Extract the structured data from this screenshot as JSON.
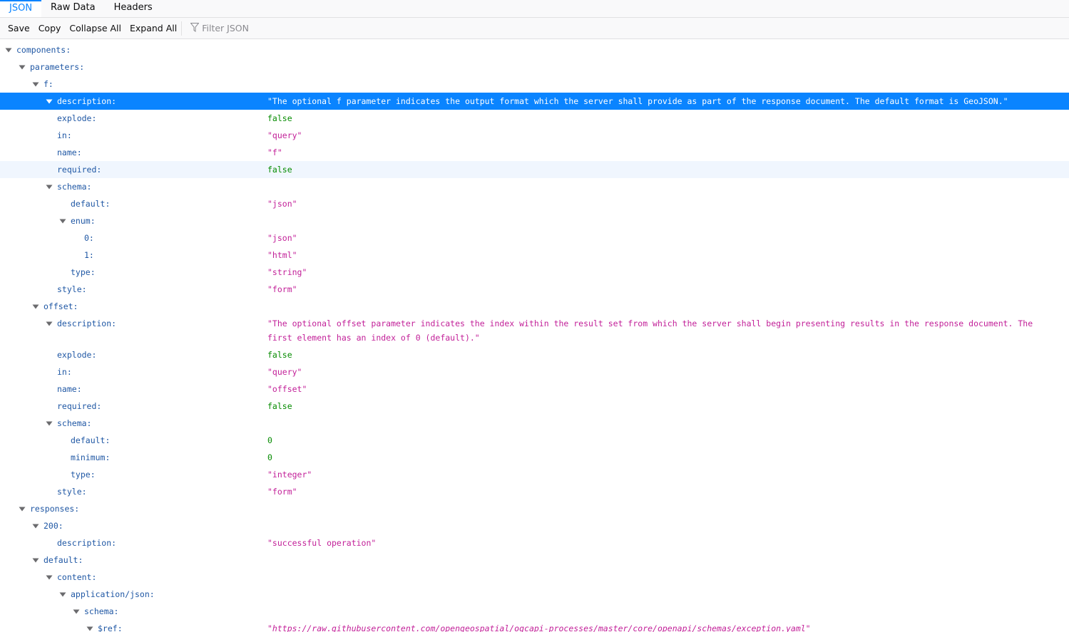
{
  "tabs": {
    "json": "JSON",
    "raw": "Raw Data",
    "headers": "Headers"
  },
  "toolbar": {
    "save": "Save",
    "copy": "Copy",
    "collapse_all": "Collapse All",
    "expand_all": "Expand All",
    "filter_placeholder": "Filter JSON"
  },
  "rows": [
    {
      "depth": 0,
      "key": "components:",
      "tw": true,
      "value": "",
      "type": ""
    },
    {
      "depth": 1,
      "key": "parameters:",
      "tw": true,
      "value": "",
      "type": ""
    },
    {
      "depth": 2,
      "key": "f:",
      "tw": true,
      "value": "",
      "type": ""
    },
    {
      "depth": 3,
      "key": "description:",
      "tw": true,
      "value": "\"The optional f parameter indicates the output format which the server shall provide as part of the response document.  The default format is GeoJSON.\"",
      "type": "str",
      "state": "selected"
    },
    {
      "depth": 3,
      "key": "explode:",
      "tw": false,
      "value": "false",
      "type": "bool"
    },
    {
      "depth": 3,
      "key": "in:",
      "tw": false,
      "value": "\"query\"",
      "type": "str"
    },
    {
      "depth": 3,
      "key": "name:",
      "tw": false,
      "value": "\"f\"",
      "type": "str"
    },
    {
      "depth": 3,
      "key": "required:",
      "tw": false,
      "value": "false",
      "type": "bool",
      "state": "hover"
    },
    {
      "depth": 3,
      "key": "schema:",
      "tw": true,
      "value": "",
      "type": ""
    },
    {
      "depth": 4,
      "key": "default:",
      "tw": false,
      "value": "\"json\"",
      "type": "str"
    },
    {
      "depth": 4,
      "key": "enum:",
      "tw": true,
      "value": "",
      "type": ""
    },
    {
      "depth": 5,
      "key": "0:",
      "tw": false,
      "value": "\"json\"",
      "type": "str"
    },
    {
      "depth": 5,
      "key": "1:",
      "tw": false,
      "value": "\"html\"",
      "type": "str"
    },
    {
      "depth": 4,
      "key": "type:",
      "tw": false,
      "value": "\"string\"",
      "type": "str"
    },
    {
      "depth": 3,
      "key": "style:",
      "tw": false,
      "value": "\"form\"",
      "type": "str"
    },
    {
      "depth": 2,
      "key": "offset:",
      "tw": true,
      "value": "",
      "type": ""
    },
    {
      "depth": 3,
      "key": "description:",
      "tw": true,
      "value": "\"The optional offset parameter indicates the index within the result set from which the server shall begin presenting results in the response document.  The first element has an index of 0 (default).\"",
      "type": "str",
      "tall": true
    },
    {
      "depth": 3,
      "key": "explode:",
      "tw": false,
      "value": "false",
      "type": "bool"
    },
    {
      "depth": 3,
      "key": "in:",
      "tw": false,
      "value": "\"query\"",
      "type": "str"
    },
    {
      "depth": 3,
      "key": "name:",
      "tw": false,
      "value": "\"offset\"",
      "type": "str"
    },
    {
      "depth": 3,
      "key": "required:",
      "tw": false,
      "value": "false",
      "type": "bool"
    },
    {
      "depth": 3,
      "key": "schema:",
      "tw": true,
      "value": "",
      "type": ""
    },
    {
      "depth": 4,
      "key": "default:",
      "tw": false,
      "value": "0",
      "type": "num"
    },
    {
      "depth": 4,
      "key": "minimum:",
      "tw": false,
      "value": "0",
      "type": "num"
    },
    {
      "depth": 4,
      "key": "type:",
      "tw": false,
      "value": "\"integer\"",
      "type": "str"
    },
    {
      "depth": 3,
      "key": "style:",
      "tw": false,
      "value": "\"form\"",
      "type": "str"
    },
    {
      "depth": 1,
      "key": "responses:",
      "tw": true,
      "value": "",
      "type": ""
    },
    {
      "depth": 2,
      "key": "200:",
      "tw": true,
      "value": "",
      "type": ""
    },
    {
      "depth": 3,
      "key": "description:",
      "tw": false,
      "value": "\"successful operation\"",
      "type": "str"
    },
    {
      "depth": 2,
      "key": "default:",
      "tw": true,
      "value": "",
      "type": ""
    },
    {
      "depth": 3,
      "key": "content:",
      "tw": true,
      "value": "",
      "type": ""
    },
    {
      "depth": 4,
      "key": "application/json:",
      "tw": true,
      "value": "",
      "type": ""
    },
    {
      "depth": 5,
      "key": "schema:",
      "tw": true,
      "value": "",
      "type": ""
    },
    {
      "depth": 6,
      "key": "$ref:",
      "tw": true,
      "value": "\"https://raw.githubusercontent.com/opengeospatial/ogcapi-processes/master/core/openapi/schemas/exception.yaml\"",
      "type": "url"
    }
  ]
}
